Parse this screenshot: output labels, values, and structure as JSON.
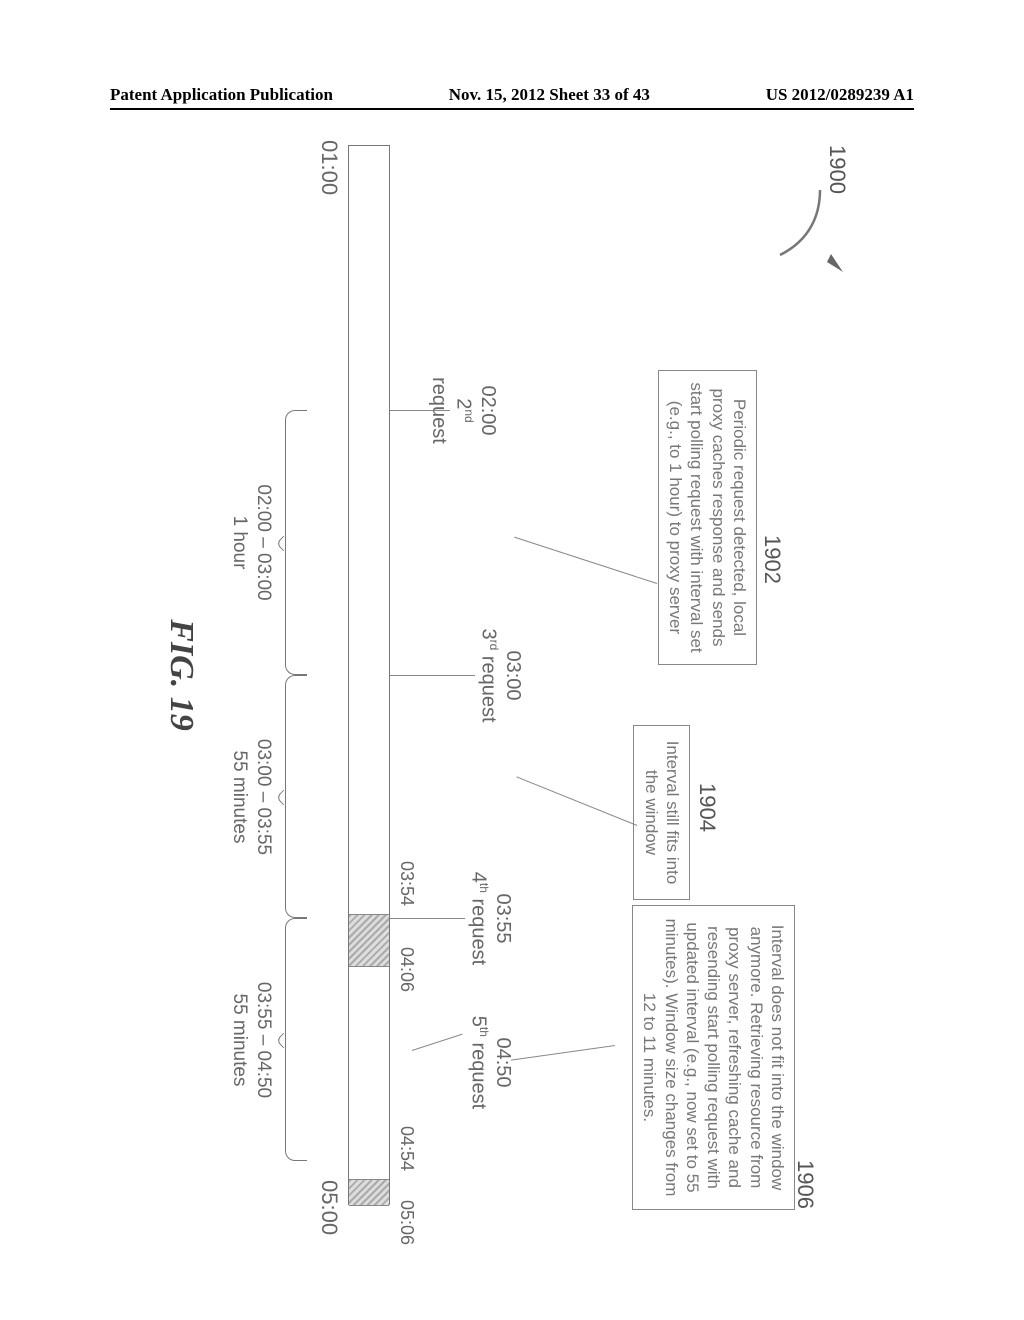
{
  "header": {
    "left": "Patent Application Publication",
    "center": "Nov. 15, 2012  Sheet 33 of 43",
    "right": "US 2012/0289239 A1"
  },
  "figure": {
    "reference": "1900",
    "caption": "FIG. 19",
    "callouts": {
      "c1902": "1902",
      "c1904": "1904",
      "c1906": "1906"
    },
    "boxes": {
      "b1902": "Periodic request detected, local proxy caches response and sends start polling request with interval set (e.g., to 1 hour) to proxy server",
      "b1904": "Interval still fits into the window",
      "b1906": "Interval does not fit into the window anymore. Retrieving resource from proxy server, refreshing cache and resending start polling request with updated interval (e.g., now set to 55 minutes). Window size changes from 12 to 11 minutes."
    },
    "requests": {
      "r2_time": "02:00",
      "r2_label": "2",
      "r2_suffix": "nd",
      "r3_time": "03:00",
      "r3_label": "3",
      "r3_suffix": "rd",
      "r4_time": "03:55",
      "r4_label": "4",
      "r4_suffix": "th",
      "r5_time": "04:50",
      "r5_label": "5",
      "r5_suffix": "th",
      "request_word": " request"
    },
    "ticks_bottom": {
      "t0100": "01:00",
      "t0500": "05:00"
    },
    "ticks_top": {
      "w1a": "03:54",
      "w1b": "04:06",
      "w2a": "04:54",
      "w2b": "05:06"
    },
    "intervals": {
      "i1_range": "02:00 – 03:00",
      "i1_dur": "1 hour",
      "i2_range": "03:00 – 03:55",
      "i2_dur": "55 minutes",
      "i3_range": "03:55 – 04:50",
      "i3_dur": "55 minutes"
    }
  },
  "chart_data": {
    "type": "timeline",
    "unit": "hh:mm",
    "axis_range": [
      "01:00",
      "05:00"
    ],
    "events": [
      {
        "label": "2nd request",
        "time": "02:00",
        "callout": 1902
      },
      {
        "label": "3rd request",
        "time": "03:00",
        "callout": 1902
      },
      {
        "label": "4th request",
        "time": "03:55",
        "callout": 1904
      },
      {
        "label": "5th request",
        "time": "04:50",
        "callout": 1906
      }
    ],
    "windows": [
      {
        "start": "03:54",
        "end": "04:06"
      },
      {
        "start": "04:54",
        "end": "05:06"
      }
    ],
    "intervals": [
      {
        "from": "02:00",
        "to": "03:00",
        "duration_min": 60
      },
      {
        "from": "03:00",
        "to": "03:55",
        "duration_min": 55
      },
      {
        "from": "03:55",
        "to": "04:50",
        "duration_min": 55
      }
    ]
  }
}
